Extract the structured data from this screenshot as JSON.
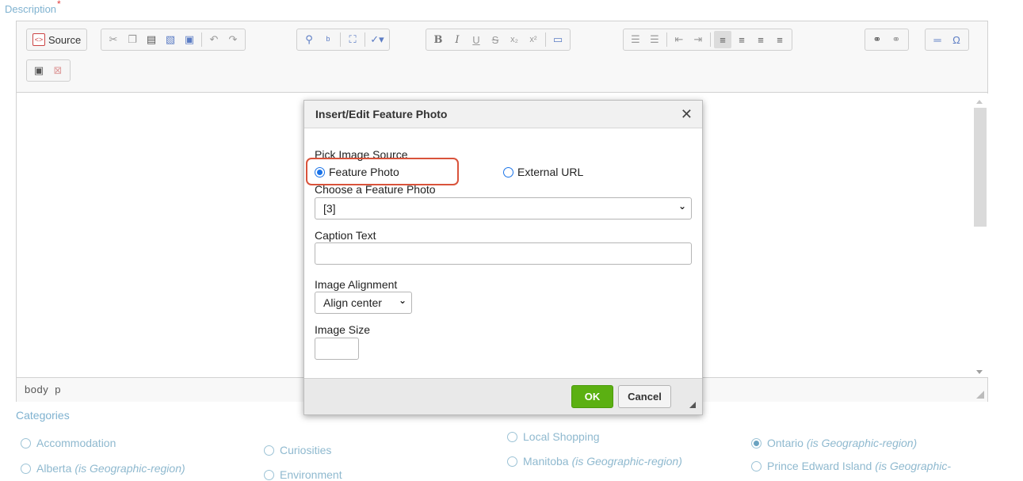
{
  "description": {
    "label": "Description",
    "required_mark": "*"
  },
  "toolbar": {
    "source_label": "Source",
    "bold": "B",
    "italic": "I",
    "underline": "U",
    "strike": "S",
    "subscript": "x₂",
    "superscript": "x²",
    "special_char": "Ω"
  },
  "statusbar": {
    "path": [
      "body",
      "p"
    ]
  },
  "dialog": {
    "title": "Insert/Edit Feature Photo",
    "pick_source_label": "Pick Image Source",
    "option_feature": "Feature Photo",
    "option_external": "External URL",
    "choose_label": "Choose a Feature Photo",
    "choose_value": "[3]",
    "caption_label": "Caption Text",
    "caption_value": "",
    "alignment_label": "Image Alignment",
    "alignment_value": "Align center",
    "size_label": "Image Size",
    "size_value": "",
    "ok": "OK",
    "cancel": "Cancel"
  },
  "categories": {
    "label": "Categories",
    "geo_suffix": "(is Geographic-region)",
    "geo_suffix_partial": "(is Geographic-",
    "items": [
      {
        "name": "Accommodation"
      },
      {
        "name": "Alberta"
      },
      {
        "name": "Curiosities"
      },
      {
        "name": "Environment"
      },
      {
        "name": "Local Shopping"
      },
      {
        "name": "Manitoba"
      },
      {
        "name": "Ontario",
        "selected": true
      },
      {
        "name": "Prince Edward Island"
      }
    ]
  },
  "colors": {
    "ok_button": "#5bb012",
    "highlight": "#d9533b",
    "label_blue": "#7fb2d0"
  }
}
